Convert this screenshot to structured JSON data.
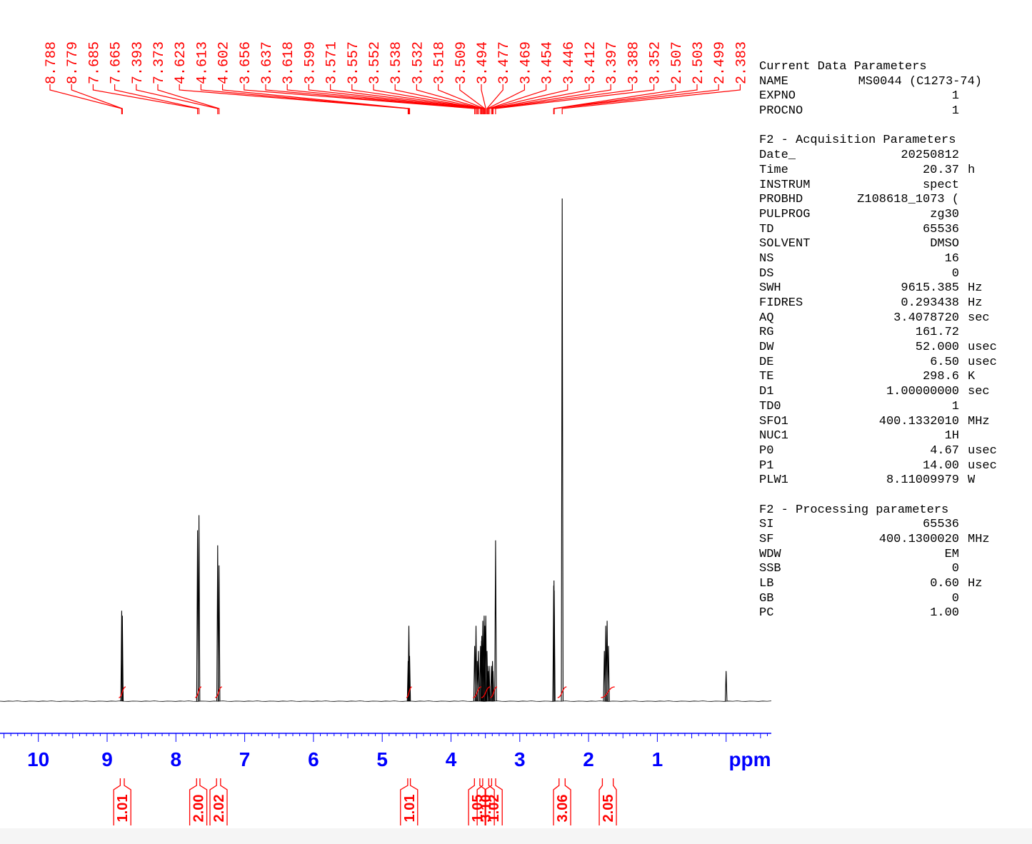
{
  "chart_data": {
    "type": "line",
    "title": "",
    "xlabel": "ppm",
    "ylabel": "",
    "xlim": [
      11.0,
      -0.6
    ],
    "x_ticks": [
      "10",
      "9",
      "8",
      "7",
      "6",
      "5",
      "4",
      "3",
      "2",
      "1"
    ],
    "grid": false,
    "colors": {
      "spectrum": "#000000",
      "annotation": "#ff0000",
      "axis": "#0000ff"
    },
    "peaks": [
      {
        "ppm": 8.788,
        "height": 0.18
      },
      {
        "ppm": 8.779,
        "height": 0.17
      },
      {
        "ppm": 7.685,
        "height": 0.34
      },
      {
        "ppm": 7.665,
        "height": 0.37
      },
      {
        "ppm": 7.393,
        "height": 0.31
      },
      {
        "ppm": 7.373,
        "height": 0.27
      },
      {
        "ppm": 4.623,
        "height": 0.08
      },
      {
        "ppm": 4.613,
        "height": 0.15
      },
      {
        "ppm": 4.602,
        "height": 0.09
      },
      {
        "ppm": 3.656,
        "height": 0.11
      },
      {
        "ppm": 3.637,
        "height": 0.15
      },
      {
        "ppm": 3.618,
        "height": 0.08
      },
      {
        "ppm": 3.599,
        "height": 0.1
      },
      {
        "ppm": 3.571,
        "height": 0.11
      },
      {
        "ppm": 3.557,
        "height": 0.12
      },
      {
        "ppm": 3.552,
        "height": 0.13
      },
      {
        "ppm": 3.538,
        "height": 0.16
      },
      {
        "ppm": 3.532,
        "height": 0.11
      },
      {
        "ppm": 3.518,
        "height": 0.17
      },
      {
        "ppm": 3.509,
        "height": 0.15
      },
      {
        "ppm": 3.494,
        "height": 0.17
      },
      {
        "ppm": 3.477,
        "height": 0.1
      },
      {
        "ppm": 3.469,
        "height": 0.07
      },
      {
        "ppm": 3.454,
        "height": 0.06
      },
      {
        "ppm": 3.446,
        "height": 0.07
      },
      {
        "ppm": 3.412,
        "height": 0.07
      },
      {
        "ppm": 3.397,
        "height": 0.08
      },
      {
        "ppm": 3.388,
        "height": 0.06
      },
      {
        "ppm": 3.352,
        "height": 0.32
      },
      {
        "ppm": 2.507,
        "height": 0.23
      },
      {
        "ppm": 2.503,
        "height": 0.24
      },
      {
        "ppm": 2.499,
        "height": 0.22
      },
      {
        "ppm": 2.383,
        "height": 1.0
      },
      {
        "ppm": 1.77,
        "height": 0.1
      },
      {
        "ppm": 1.75,
        "height": 0.15
      },
      {
        "ppm": 1.73,
        "height": 0.16
      },
      {
        "ppm": 1.71,
        "height": 0.11
      },
      {
        "ppm": 0.0,
        "height": 0.06
      }
    ],
    "peak_labels": [
      "8.788",
      "8.779",
      "7.685",
      "7.665",
      "7.393",
      "7.373",
      "4.623",
      "4.613",
      "4.602",
      "3.656",
      "3.637",
      "3.618",
      "3.599",
      "3.571",
      "3.557",
      "3.552",
      "3.538",
      "3.532",
      "3.518",
      "3.509",
      "3.494",
      "3.477",
      "3.469",
      "3.454",
      "3.446",
      "3.412",
      "3.397",
      "3.388",
      "3.352",
      "2.507",
      "2.503",
      "2.499",
      "2.383"
    ],
    "integrals": [
      {
        "value": "1.01",
        "from": 8.83,
        "to": 8.73
      },
      {
        "value": "2.00",
        "from": 7.72,
        "to": 7.63
      },
      {
        "value": "2.02",
        "from": 7.43,
        "to": 7.33
      },
      {
        "value": "1.01",
        "from": 4.65,
        "to": 4.57
      },
      {
        "value": "1.05",
        "from": 3.68,
        "to": 3.56
      },
      {
        "value": "3.10",
        "from": 3.56,
        "to": 3.43
      },
      {
        "value": "1.02",
        "from": 3.43,
        "to": 3.33
      },
      {
        "value": "3.06",
        "from": 2.45,
        "to": 2.32
      },
      {
        "value": "2.05",
        "from": 1.82,
        "to": 1.62
      }
    ]
  },
  "params": {
    "sections": [
      {
        "title": "Current Data Parameters",
        "rows": [
          {
            "name": "NAME",
            "value": "MS0044 (C1273-74)",
            "unit": ""
          },
          {
            "name": "EXPNO",
            "value": "1",
            "unit": ""
          },
          {
            "name": "PROCNO",
            "value": "1",
            "unit": ""
          }
        ]
      },
      {
        "title": "F2 - Acquisition Parameters",
        "rows": [
          {
            "name": "Date_",
            "value": "20250812",
            "unit": ""
          },
          {
            "name": "Time",
            "value": "20.37",
            "unit": "h"
          },
          {
            "name": "INSTRUM",
            "value": "spect",
            "unit": ""
          },
          {
            "name": "PROBHD",
            "value": "Z108618_1073 (",
            "unit": ""
          },
          {
            "name": "PULPROG",
            "value": "zg30",
            "unit": ""
          },
          {
            "name": "TD",
            "value": "65536",
            "unit": ""
          },
          {
            "name": "SOLVENT",
            "value": "DMSO",
            "unit": ""
          },
          {
            "name": "NS",
            "value": "16",
            "unit": ""
          },
          {
            "name": "DS",
            "value": "0",
            "unit": ""
          },
          {
            "name": "SWH",
            "value": "9615.385",
            "unit": "Hz"
          },
          {
            "name": "FIDRES",
            "value": "0.293438",
            "unit": "Hz"
          },
          {
            "name": "AQ",
            "value": "3.4078720",
            "unit": "sec"
          },
          {
            "name": "RG",
            "value": "161.72",
            "unit": ""
          },
          {
            "name": "DW",
            "value": "52.000",
            "unit": "usec"
          },
          {
            "name": "DE",
            "value": "6.50",
            "unit": "usec"
          },
          {
            "name": "TE",
            "value": "298.6",
            "unit": "K"
          },
          {
            "name": "D1",
            "value": "1.00000000",
            "unit": "sec"
          },
          {
            "name": "TD0",
            "value": "1",
            "unit": ""
          },
          {
            "name": "SFO1",
            "value": "400.1332010",
            "unit": "MHz"
          },
          {
            "name": "NUC1",
            "value": "1H",
            "unit": ""
          },
          {
            "name": "P0",
            "value": "4.67",
            "unit": "usec"
          },
          {
            "name": "P1",
            "value": "14.00",
            "unit": "usec"
          },
          {
            "name": "PLW1",
            "value": "8.11009979",
            "unit": "W"
          }
        ]
      },
      {
        "title": "F2 - Processing parameters",
        "rows": [
          {
            "name": "SI",
            "value": "65536",
            "unit": ""
          },
          {
            "name": "SF",
            "value": "400.1300020",
            "unit": "MHz"
          },
          {
            "name": "WDW",
            "value": "EM",
            "unit": ""
          },
          {
            "name": "SSB",
            "value": "0",
            "unit": ""
          },
          {
            "name": "LB",
            "value": "0.60",
            "unit": "Hz"
          },
          {
            "name": "GB",
            "value": "0",
            "unit": ""
          },
          {
            "name": "PC",
            "value": "1.00",
            "unit": ""
          }
        ]
      }
    ]
  }
}
